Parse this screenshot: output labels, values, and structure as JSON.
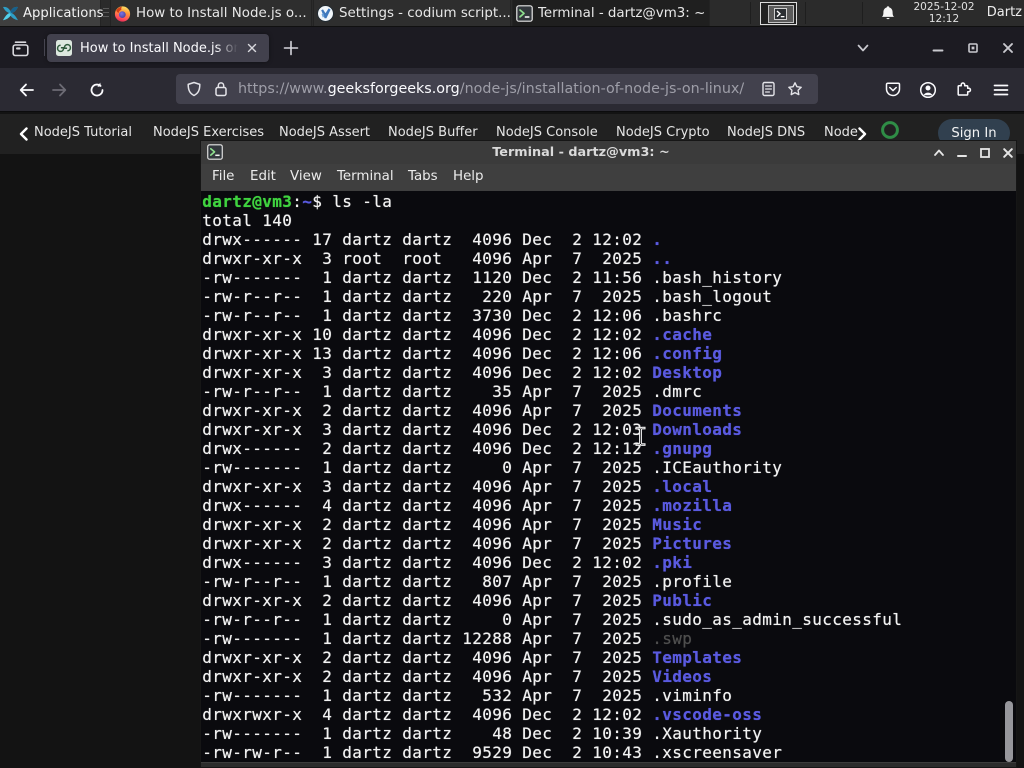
{
  "colors": {
    "panel_bg": "#2b2b2b",
    "taskbtn_bg": "#2e2e2e",
    "taskbtn_active_bg": "#1f1f1f",
    "firefox_tabbar_bg": "#1c1b22",
    "firefox_toolbar_bg": "#2b2a33",
    "urlbar_bg": "#42414d",
    "gfg_navbar_bg": "#212121",
    "gfg_green": "#2f8d46",
    "signin_bg": "#31404f",
    "terminal_bg": "#0a0a0e",
    "terminal_green": "#3fd33f",
    "terminal_blue": "#5a5ae0",
    "terminal_dim": "#4e4e4e",
    "titlebar_bg": "#3b3b3b"
  },
  "panel": {
    "applications_label": "Applications",
    "tasks": [
      {
        "icon": "firefox-icon",
        "label": "How to Install Node.js o..."
      },
      {
        "icon": "vscodium-icon",
        "label": "Settings - codium script..."
      },
      {
        "icon": "terminal-icon",
        "label": "Terminal - dartz@vm3: ~"
      }
    ],
    "clock_date": "2025-12-02",
    "clock_time": "12:12",
    "user_label": "Dartz"
  },
  "browser": {
    "tab_title": "How to Install Node.js on",
    "url_prefix": "https://www.",
    "url_domain": "geeksforgeeks.org",
    "url_path": "/node-js/installation-of-node-js-on-linux/"
  },
  "site_nav": {
    "items": [
      "NodeJS Tutorial",
      "NodeJS Exercises",
      "NodeJS Assert",
      "NodeJS Buffer",
      "NodeJS Console",
      "NodeJS Crypto",
      "NodeJS DNS",
      "Node"
    ],
    "sign_in_label": "Sign In"
  },
  "terminal": {
    "window_title": "Terminal - dartz@vm3: ~",
    "menu": [
      "File",
      "Edit",
      "View",
      "Terminal",
      "Tabs",
      "Help"
    ],
    "prompt_user_host": "dartz@vm3",
    "prompt_colon": ":",
    "prompt_cwd": "~",
    "prompt_dollar": "$ ",
    "prompt_command": "ls -la",
    "total_line": "total 140",
    "rows": [
      [
        "drwx------ 17 dartz dartz  4096 Dec  2 12:02 ",
        ".",
        "d"
      ],
      [
        "drwxr-xr-x  3 root  root   4096 Apr  7  2025 ",
        "..",
        "d"
      ],
      [
        "-rw-------  1 dartz dartz  1120 Dec  2 11:56 ",
        ".bash_history",
        "f"
      ],
      [
        "-rw-r--r--  1 dartz dartz   220 Apr  7  2025 ",
        ".bash_logout",
        "f"
      ],
      [
        "-rw-r--r--  1 dartz dartz  3730 Dec  2 12:06 ",
        ".bashrc",
        "f"
      ],
      [
        "drwxr-xr-x 10 dartz dartz  4096 Dec  2 12:02 ",
        ".cache",
        "d"
      ],
      [
        "drwxr-xr-x 13 dartz dartz  4096 Dec  2 12:06 ",
        ".config",
        "d"
      ],
      [
        "drwxr-xr-x  3 dartz dartz  4096 Dec  2 12:02 ",
        "Desktop",
        "d"
      ],
      [
        "-rw-r--r--  1 dartz dartz    35 Apr  7  2025 ",
        ".dmrc",
        "f"
      ],
      [
        "drwxr-xr-x  2 dartz dartz  4096 Apr  7  2025 ",
        "Documents",
        "d"
      ],
      [
        "drwxr-xr-x  3 dartz dartz  4096 Dec  2 12:03 ",
        "Downloads",
        "d"
      ],
      [
        "drwx------  2 dartz dartz  4096 Dec  2 12:12 ",
        ".gnupg",
        "d"
      ],
      [
        "-rw-------  1 dartz dartz     0 Apr  7  2025 ",
        ".ICEauthority",
        "f"
      ],
      [
        "drwxr-xr-x  3 dartz dartz  4096 Apr  7  2025 ",
        ".local",
        "d"
      ],
      [
        "drwx------  4 dartz dartz  4096 Apr  7  2025 ",
        ".mozilla",
        "d"
      ],
      [
        "drwxr-xr-x  2 dartz dartz  4096 Apr  7  2025 ",
        "Music",
        "d"
      ],
      [
        "drwxr-xr-x  2 dartz dartz  4096 Apr  7  2025 ",
        "Pictures",
        "d"
      ],
      [
        "drwx------  3 dartz dartz  4096 Dec  2 12:02 ",
        ".pki",
        "d"
      ],
      [
        "-rw-r--r--  1 dartz dartz   807 Apr  7  2025 ",
        ".profile",
        "f"
      ],
      [
        "drwxr-xr-x  2 dartz dartz  4096 Apr  7  2025 ",
        "Public",
        "d"
      ],
      [
        "-rw-r--r--  1 dartz dartz     0 Apr  7  2025 ",
        ".sudo_as_admin_successful",
        "f"
      ],
      [
        "-rw-------  1 dartz dartz 12288 Apr  7  2025 ",
        ".swp",
        "x"
      ],
      [
        "drwxr-xr-x  2 dartz dartz  4096 Apr  7  2025 ",
        "Templates",
        "d"
      ],
      [
        "drwxr-xr-x  2 dartz dartz  4096 Apr  7  2025 ",
        "Videos",
        "d"
      ],
      [
        "-rw-------  1 dartz dartz   532 Apr  7  2025 ",
        ".viminfo",
        "f"
      ],
      [
        "drwxrwxr-x  4 dartz dartz  4096 Dec  2 12:02 ",
        ".vscode-oss",
        "d"
      ],
      [
        "-rw-------  1 dartz dartz    48 Dec  2 10:39 ",
        ".Xauthority",
        "f"
      ],
      [
        "-rw-rw-r--  1 dartz dartz  9529 Dec  2 10:43 ",
        ".xscreensaver",
        "f"
      ]
    ]
  }
}
